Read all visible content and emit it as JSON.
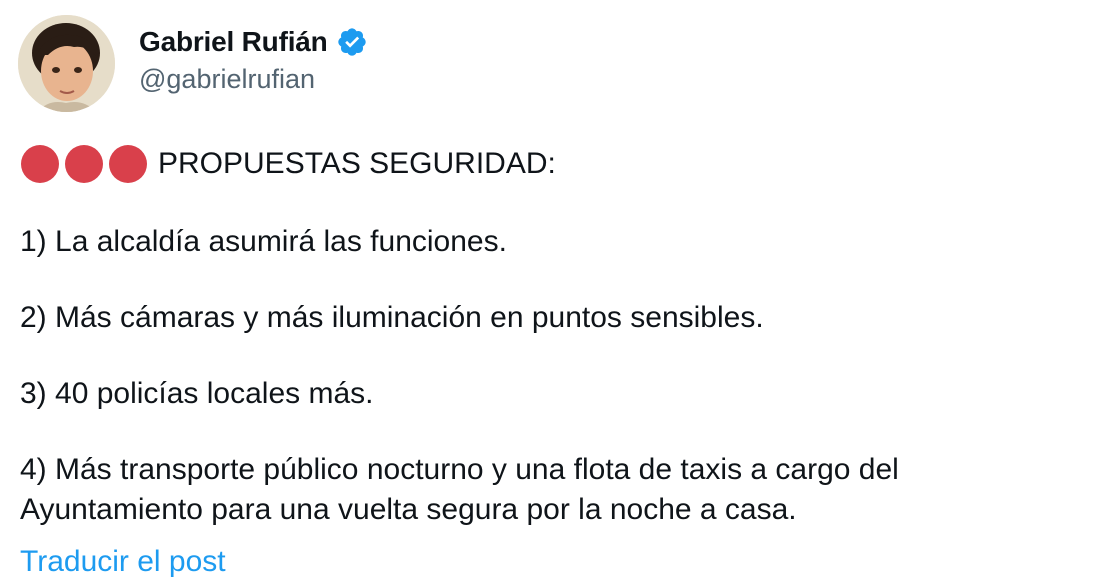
{
  "author": {
    "display_name": "Gabriel Rufián",
    "handle": "@gabrielrufian",
    "verified": true,
    "verified_color": "#1d9bf0"
  },
  "tweet": {
    "emoji_dots": [
      "red-circle-icon",
      "red-circle-icon",
      "red-circle-icon"
    ],
    "emoji_color": "#d9404b",
    "headline": "PROPUESTAS SEGURIDAD:",
    "items": [
      "1) La alcaldía asumirá las funciones.",
      "2) Más cámaras y más iluminación en puntos sensibles.",
      "3) 40 policías locales más.",
      "4) Más transporte público nocturno y una flota de taxis a cargo del Ayuntamiento para una vuelta segura por la noche a casa."
    ],
    "translate_link": "Traducir el post"
  }
}
